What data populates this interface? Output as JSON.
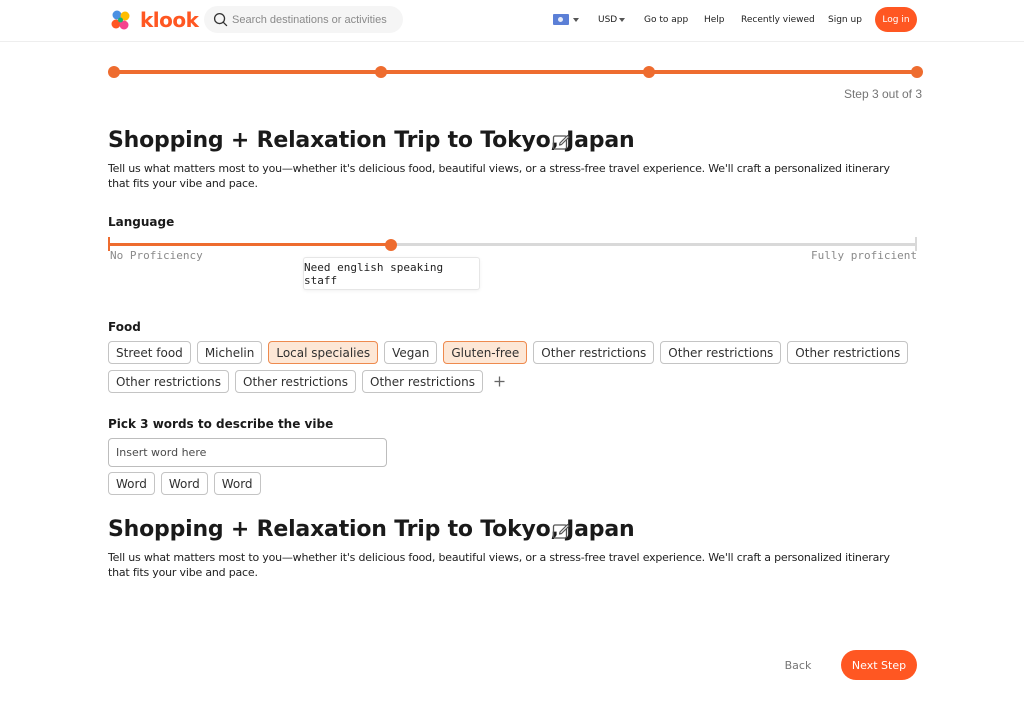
{
  "header": {
    "logo_text": "klook",
    "search_placeholder": "Search destinations or activities",
    "currency": "USD",
    "nav": [
      "Go to app",
      "Help",
      "Recently viewed",
      "Sign up"
    ],
    "login_label": "Log in",
    "brand_color": "#ff5722"
  },
  "progress": {
    "current_step": 3,
    "total_steps": 3,
    "label": "Step 3 out of 3"
  },
  "intro": {
    "title": "Shopping + Relaxation Trip to Tokyo, Japan",
    "description": "Tell us what matters most to you—whether it's delicious food, beautiful views, or a stress-free travel experience. We'll craft a personalized itinerary that fits your vibe and pace."
  },
  "language": {
    "label": "Language",
    "min_label": "No Proficiency",
    "max_label": "Fully proficient",
    "value_fraction": 0.35,
    "tooltip": "Need english speaking staff"
  },
  "food": {
    "label": "Food",
    "chips": [
      {
        "label": "Street food",
        "selected": false
      },
      {
        "label": "Michelin",
        "selected": false
      },
      {
        "label": "Local specialies",
        "selected": true
      },
      {
        "label": "Vegan",
        "selected": false
      },
      {
        "label": "Gluten-free",
        "selected": true
      },
      {
        "label": "Other restrictions",
        "selected": false
      },
      {
        "label": "Other restrictions",
        "selected": false
      },
      {
        "label": "Other restrictions",
        "selected": false
      },
      {
        "label": "Other restrictions",
        "selected": false
      },
      {
        "label": "Other restrictions",
        "selected": false
      },
      {
        "label": "Other restrictions",
        "selected": false
      }
    ],
    "add_icon": "plus-icon"
  },
  "vibe": {
    "label": "Pick 3 words to describe the vibe",
    "placeholder": "Insert word here",
    "words": [
      "Word",
      "Word",
      "Word"
    ]
  },
  "repeat": {
    "title": "Shopping + Relaxation Trip to Tokyo, Japan",
    "description": "Tell us what matters most to you—whether it's delicious food, beautiful views, or a stress-free travel experience. We'll craft a personalized itinerary that fits your vibe and pace."
  },
  "footer": {
    "back_label": "Back",
    "next_label": "Next Step"
  },
  "colors": {
    "accent": "#ee6c2f",
    "selected_chip_bg": "#fde7d6"
  }
}
